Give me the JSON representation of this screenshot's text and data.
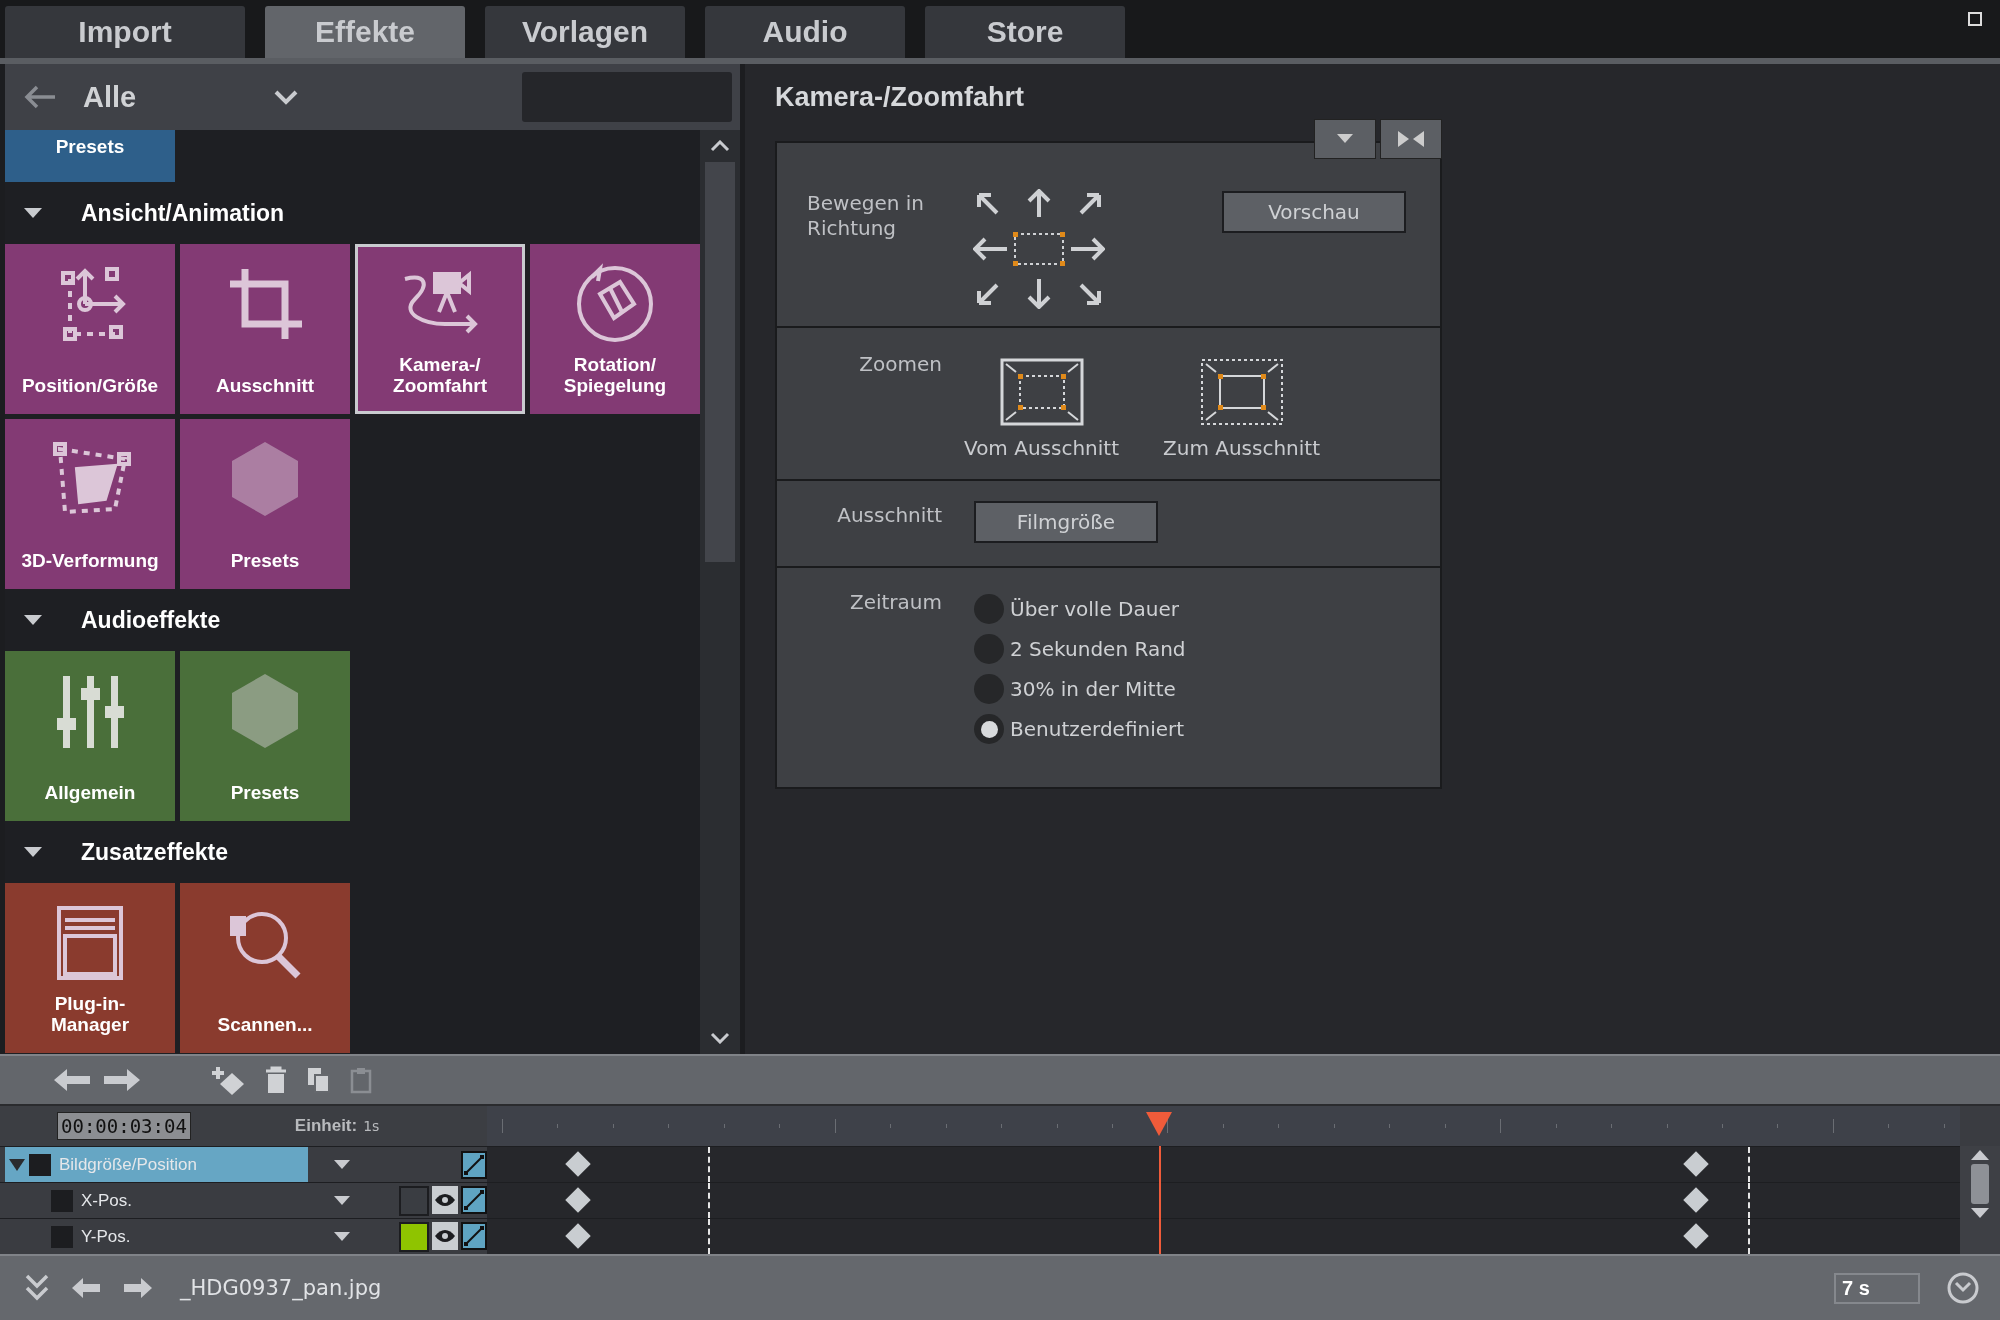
{
  "tabs": [
    {
      "label": "Import",
      "selected": false
    },
    {
      "label": "Effekte",
      "selected": true
    },
    {
      "label": "Vorlagen",
      "selected": false
    },
    {
      "label": "Audio",
      "selected": false
    },
    {
      "label": "Store",
      "selected": false
    }
  ],
  "browser": {
    "category": "Alle",
    "scrolled_tile": {
      "label": "Presets",
      "color": "#2e5f8a"
    },
    "sections": [
      {
        "title": "Ansicht/Animation",
        "expanded": true,
        "color": "#833a74",
        "tiles": [
          {
            "label": "Position/Größe",
            "kind": "position",
            "selected": false
          },
          {
            "label": "Ausschnitt",
            "kind": "crop",
            "selected": false
          },
          {
            "label": "Kamera-/ Zoomfahrt",
            "kind": "camera",
            "selected": true
          },
          {
            "label": "Rotation/ Spiegelung",
            "kind": "rotation",
            "selected": false
          },
          {
            "label": "3D-Verformung",
            "kind": "warp",
            "selected": false
          },
          {
            "label": "Presets",
            "kind": "preset",
            "selected": false
          }
        ]
      },
      {
        "title": "Audioeffekte",
        "expanded": true,
        "color": "#4a6f3a",
        "tiles": [
          {
            "label": "Allgemein",
            "kind": "mixer",
            "selected": false
          },
          {
            "label": "Presets",
            "kind": "preset",
            "selected": false
          }
        ]
      },
      {
        "title": "Zusatzeffekte",
        "expanded": true,
        "color": "#8a3b2e",
        "tiles": [
          {
            "label": "Plug-in- Manager",
            "kind": "plugin",
            "selected": false
          },
          {
            "label": "Scannen...",
            "kind": "scan",
            "selected": false
          }
        ]
      }
    ]
  },
  "effect": {
    "title": "Kamera-/Zoomfahrt",
    "move": {
      "label": "Bewegen in Richtung",
      "button": "Vorschau"
    },
    "zoom": {
      "label": "Zoomen",
      "options": [
        {
          "label": "Vom Ausschnitt",
          "kind": "from"
        },
        {
          "label": "Zum Ausschnitt",
          "kind": "to"
        }
      ]
    },
    "crop": {
      "label": "Ausschnitt",
      "button": "Filmgröße"
    },
    "period": {
      "label": "Zeitraum",
      "options": [
        {
          "label": "Über volle Dauer",
          "selected": false
        },
        {
          "label": "2 Sekunden Rand",
          "selected": false
        },
        {
          "label": "30% in der Mitte",
          "selected": false
        },
        {
          "label": "Benutzerdefiniert",
          "selected": true
        }
      ]
    }
  },
  "timeline": {
    "time": "00:00:03:04",
    "unit_label": "Einheit:",
    "unit": "1s",
    "playhead": {
      "level": 0.456
    },
    "tracks": [
      {
        "name": "Bildgröße/Position",
        "kind": "group",
        "selected": true,
        "expanded": true
      },
      {
        "name": "X-Pos.",
        "kind": "param",
        "selected": false,
        "color": "#3a3d42"
      },
      {
        "name": "Y-Pos.",
        "kind": "param",
        "selected": false,
        "color": "#8fc400"
      }
    ]
  },
  "status_bar": {
    "file": "_HDG0937_pan.jpg",
    "duration": "7 s"
  }
}
